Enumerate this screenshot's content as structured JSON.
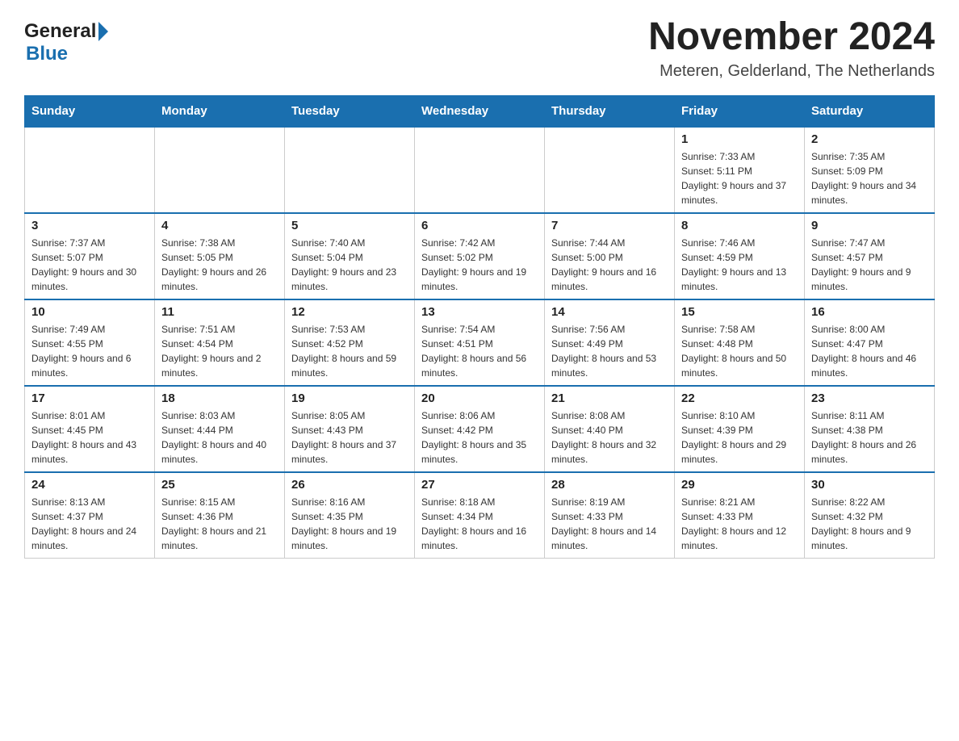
{
  "header": {
    "logo_general": "General",
    "logo_blue": "Blue",
    "month_title": "November 2024",
    "location": "Meteren, Gelderland, The Netherlands"
  },
  "days_of_week": [
    "Sunday",
    "Monday",
    "Tuesday",
    "Wednesday",
    "Thursday",
    "Friday",
    "Saturday"
  ],
  "weeks": [
    [
      {
        "day": "",
        "info": ""
      },
      {
        "day": "",
        "info": ""
      },
      {
        "day": "",
        "info": ""
      },
      {
        "day": "",
        "info": ""
      },
      {
        "day": "",
        "info": ""
      },
      {
        "day": "1",
        "info": "Sunrise: 7:33 AM\nSunset: 5:11 PM\nDaylight: 9 hours and 37 minutes."
      },
      {
        "day": "2",
        "info": "Sunrise: 7:35 AM\nSunset: 5:09 PM\nDaylight: 9 hours and 34 minutes."
      }
    ],
    [
      {
        "day": "3",
        "info": "Sunrise: 7:37 AM\nSunset: 5:07 PM\nDaylight: 9 hours and 30 minutes."
      },
      {
        "day": "4",
        "info": "Sunrise: 7:38 AM\nSunset: 5:05 PM\nDaylight: 9 hours and 26 minutes."
      },
      {
        "day": "5",
        "info": "Sunrise: 7:40 AM\nSunset: 5:04 PM\nDaylight: 9 hours and 23 minutes."
      },
      {
        "day": "6",
        "info": "Sunrise: 7:42 AM\nSunset: 5:02 PM\nDaylight: 9 hours and 19 minutes."
      },
      {
        "day": "7",
        "info": "Sunrise: 7:44 AM\nSunset: 5:00 PM\nDaylight: 9 hours and 16 minutes."
      },
      {
        "day": "8",
        "info": "Sunrise: 7:46 AM\nSunset: 4:59 PM\nDaylight: 9 hours and 13 minutes."
      },
      {
        "day": "9",
        "info": "Sunrise: 7:47 AM\nSunset: 4:57 PM\nDaylight: 9 hours and 9 minutes."
      }
    ],
    [
      {
        "day": "10",
        "info": "Sunrise: 7:49 AM\nSunset: 4:55 PM\nDaylight: 9 hours and 6 minutes."
      },
      {
        "day": "11",
        "info": "Sunrise: 7:51 AM\nSunset: 4:54 PM\nDaylight: 9 hours and 2 minutes."
      },
      {
        "day": "12",
        "info": "Sunrise: 7:53 AM\nSunset: 4:52 PM\nDaylight: 8 hours and 59 minutes."
      },
      {
        "day": "13",
        "info": "Sunrise: 7:54 AM\nSunset: 4:51 PM\nDaylight: 8 hours and 56 minutes."
      },
      {
        "day": "14",
        "info": "Sunrise: 7:56 AM\nSunset: 4:49 PM\nDaylight: 8 hours and 53 minutes."
      },
      {
        "day": "15",
        "info": "Sunrise: 7:58 AM\nSunset: 4:48 PM\nDaylight: 8 hours and 50 minutes."
      },
      {
        "day": "16",
        "info": "Sunrise: 8:00 AM\nSunset: 4:47 PM\nDaylight: 8 hours and 46 minutes."
      }
    ],
    [
      {
        "day": "17",
        "info": "Sunrise: 8:01 AM\nSunset: 4:45 PM\nDaylight: 8 hours and 43 minutes."
      },
      {
        "day": "18",
        "info": "Sunrise: 8:03 AM\nSunset: 4:44 PM\nDaylight: 8 hours and 40 minutes."
      },
      {
        "day": "19",
        "info": "Sunrise: 8:05 AM\nSunset: 4:43 PM\nDaylight: 8 hours and 37 minutes."
      },
      {
        "day": "20",
        "info": "Sunrise: 8:06 AM\nSunset: 4:42 PM\nDaylight: 8 hours and 35 minutes."
      },
      {
        "day": "21",
        "info": "Sunrise: 8:08 AM\nSunset: 4:40 PM\nDaylight: 8 hours and 32 minutes."
      },
      {
        "day": "22",
        "info": "Sunrise: 8:10 AM\nSunset: 4:39 PM\nDaylight: 8 hours and 29 minutes."
      },
      {
        "day": "23",
        "info": "Sunrise: 8:11 AM\nSunset: 4:38 PM\nDaylight: 8 hours and 26 minutes."
      }
    ],
    [
      {
        "day": "24",
        "info": "Sunrise: 8:13 AM\nSunset: 4:37 PM\nDaylight: 8 hours and 24 minutes."
      },
      {
        "day": "25",
        "info": "Sunrise: 8:15 AM\nSunset: 4:36 PM\nDaylight: 8 hours and 21 minutes."
      },
      {
        "day": "26",
        "info": "Sunrise: 8:16 AM\nSunset: 4:35 PM\nDaylight: 8 hours and 19 minutes."
      },
      {
        "day": "27",
        "info": "Sunrise: 8:18 AM\nSunset: 4:34 PM\nDaylight: 8 hours and 16 minutes."
      },
      {
        "day": "28",
        "info": "Sunrise: 8:19 AM\nSunset: 4:33 PM\nDaylight: 8 hours and 14 minutes."
      },
      {
        "day": "29",
        "info": "Sunrise: 8:21 AM\nSunset: 4:33 PM\nDaylight: 8 hours and 12 minutes."
      },
      {
        "day": "30",
        "info": "Sunrise: 8:22 AM\nSunset: 4:32 PM\nDaylight: 8 hours and 9 minutes."
      }
    ]
  ]
}
